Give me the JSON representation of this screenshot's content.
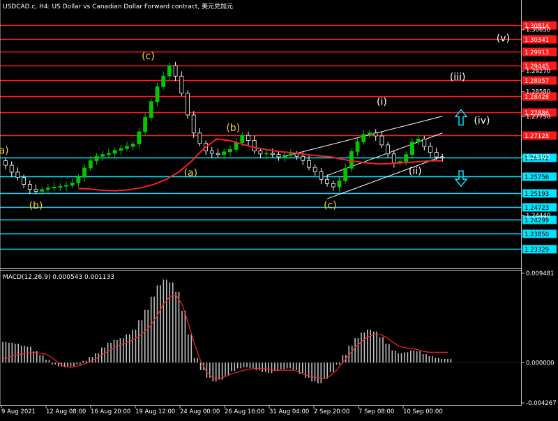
{
  "header": {
    "title": "USDCAD.c, H4:  US Dollar vs Canadian Dollar Forward contract, 美元兑加元"
  },
  "colors": {
    "background": "#000000",
    "frame": "#c0c0c0",
    "bull_candle": "#00c800",
    "bear_candle": "#ffffff",
    "red_level": "#ff1a1a",
    "cyan_level": "#00e5ff",
    "ma_line": "#ff2020",
    "channel": "#ffffff",
    "wave_orange": "#ffd21c",
    "wave_white": "#ffffff",
    "arrow": "#00e5ff",
    "macd_bar": "#c0c0c0",
    "macd_signal": "#ff2020"
  },
  "chart_data": [
    {
      "type": "candlestick",
      "symbol": "USDCAD.c",
      "timeframe": "H4",
      "ylim": [
        1.2279,
        1.3118
      ],
      "price_axis_ticks": [
        "1.30650",
        "1.29270",
        "1.28580",
        "1.27750",
        "1.26405",
        "1.24440"
      ],
      "current_price": "1.26372",
      "resistance_levels": [
        "1.30814",
        "1.30341",
        "1.29913",
        "1.29445",
        "1.28957",
        "1.28428",
        "1.27886",
        "1.27128"
      ],
      "support_levels": [
        "1.26372",
        "1.25756",
        "1.25193",
        "1.24723",
        "1.24299",
        "1.23850",
        "1.23329"
      ],
      "close_series": [
        1.2612,
        1.2589,
        1.2571,
        1.2548,
        1.2532,
        1.2525,
        1.2531,
        1.2536,
        1.2539,
        1.2542,
        1.2545,
        1.2553,
        1.2572,
        1.2603,
        1.2627,
        1.2642,
        1.2648,
        1.2652,
        1.2662,
        1.2668,
        1.2675,
        1.2683,
        1.2724,
        1.2772,
        1.2825,
        1.2875,
        1.291,
        1.2945,
        1.291,
        1.2853,
        1.278,
        1.272,
        1.2685,
        1.266,
        1.2652,
        1.2648,
        1.2657,
        1.2665,
        1.2688,
        1.2712,
        1.2695,
        1.266,
        1.265,
        1.2652,
        1.2648,
        1.264,
        1.2646,
        1.265,
        1.2642,
        1.2628,
        1.2605,
        1.259,
        1.2565,
        1.2551,
        1.254,
        1.256,
        1.2602,
        1.2658,
        1.269,
        1.2715,
        1.272,
        1.271,
        1.268,
        1.265,
        1.262,
        1.2625,
        1.2648,
        1.269,
        1.27,
        1.2675,
        1.2655,
        1.264,
        1.2637
      ],
      "moving_average": [
        1.2535,
        1.2532,
        1.2528,
        1.2527,
        1.253,
        1.2537,
        1.2548,
        1.2565,
        1.259,
        1.2625,
        1.2668,
        1.27,
        1.2695,
        1.2683,
        1.2672,
        1.2664,
        1.2658,
        1.2654,
        1.2649,
        1.2644,
        1.2641,
        1.2632,
        1.2625,
        1.262,
        1.2616,
        1.2618,
        1.2621,
        1.2624,
        1.2627,
        1.2627
      ],
      "wave_labels": [
        {
          "text": "(a)",
          "color": "orange"
        },
        {
          "text": "(b)",
          "color": "orange"
        },
        {
          "text": "(c)",
          "color": "orange"
        },
        {
          "text": "(a)",
          "color": "orange"
        },
        {
          "text": "(b)",
          "color": "orange"
        },
        {
          "text": "(c)",
          "color": "orange"
        },
        {
          "text": "(i)",
          "color": "white"
        },
        {
          "text": "(ii)",
          "color": "white"
        },
        {
          "text": "(iii)",
          "color": "white"
        },
        {
          "text": "(iv)",
          "color": "white"
        },
        {
          "text": "(v)",
          "color": "white"
        }
      ],
      "x_axis_labels": [
        "9 Aug 2021",
        "12 Aug 08:00",
        "16 Aug 20:00",
        "19 Aug 12:00",
        "24 Aug 00:00",
        "26 Aug 16:00",
        "31 Aug 04:00",
        "2 Sep 20:00",
        "7 Sep 08:00",
        "10 Sep 00:00"
      ]
    },
    {
      "type": "bar",
      "indicator": "MACD",
      "title": "MACD(12,26,9) 0.000543 0.001133",
      "ylim": [
        -0.004267,
        0.009481
      ],
      "axis_ticks": [
        "0.009481",
        "0.000000",
        "-0.004267"
      ],
      "histogram": [
        0.0022,
        0.0021,
        0.002,
        0.0018,
        0.0017,
        0.0012,
        0.0008,
        0.0003,
        -0.0002,
        -0.0004,
        -0.0005,
        -0.0004,
        -0.0002,
        0.0002,
        0.0006,
        0.001,
        0.0016,
        0.0021,
        0.0024,
        0.0026,
        0.003,
        0.0035,
        0.0045,
        0.0056,
        0.007,
        0.0082,
        0.0088,
        0.0085,
        0.0075,
        0.0055,
        0.003,
        0.0005,
        -0.0008,
        -0.0016,
        -0.002,
        -0.0018,
        -0.0014,
        -0.0009,
        -0.0006,
        -0.0005,
        -0.0006,
        -0.0008,
        -0.001,
        -0.0011,
        -0.0009,
        -0.0007,
        -0.0006,
        -0.0008,
        -0.0012,
        -0.0016,
        -0.002,
        -0.0022,
        -0.0017,
        -0.001,
        -0.0002,
        0.0008,
        0.0018,
        0.0026,
        0.0032,
        0.0035,
        0.0033,
        0.0027,
        0.002,
        0.0013,
        0.001,
        0.0011,
        0.0013,
        0.0012,
        0.0009,
        0.0007,
        0.0005,
        0.0004,
        0.0004
      ],
      "signal": [
        0.0004,
        0.0006,
        0.0008,
        0.0009,
        0.001,
        0.0011,
        0.001,
        0.0009,
        0.0005,
        0.0,
        -0.0004,
        -0.0005,
        -0.0004,
        -0.0002,
        0.0001,
        0.0004,
        0.0008,
        0.0012,
        0.0016,
        0.0019,
        0.0021,
        0.0024,
        0.0028,
        0.0033,
        0.004,
        0.005,
        0.0062,
        0.007,
        0.0072,
        0.0062,
        0.0042,
        0.002,
        0.0002,
        -0.001,
        -0.0016,
        -0.0017,
        -0.0015,
        -0.0012,
        -0.001,
        -0.0008,
        -0.0007,
        -0.0006,
        -0.0006,
        -0.0007,
        -0.0008,
        -0.0008,
        -0.0008,
        -0.0008,
        -0.001,
        -0.0013,
        -0.0015,
        -0.0016,
        -0.0017,
        -0.0014,
        -0.0008,
        0.0,
        0.0008,
        0.0016,
        0.0022,
        0.0027,
        0.003,
        0.003,
        0.0027,
        0.0022,
        0.0018,
        0.0016,
        0.0015,
        0.0014,
        0.0012,
        0.0011,
        0.0011,
        0.0011,
        0.0011
      ]
    }
  ]
}
